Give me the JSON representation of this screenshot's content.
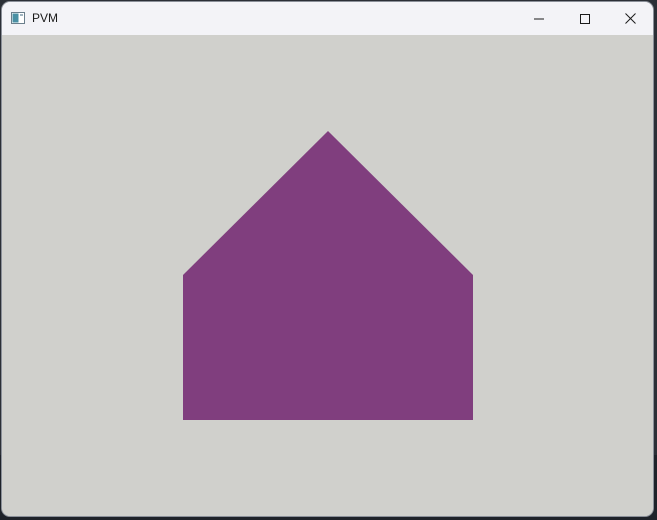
{
  "window": {
    "title": "PVM"
  },
  "titlebar": {
    "icons": {
      "app": "app-window-icon",
      "minimize": "minimize-icon",
      "maximize": "maximize-icon",
      "close": "close-icon"
    }
  },
  "scene": {
    "background_color": "#d0d0cc",
    "shape": "house-pentagon",
    "shape_color": "#803e7e"
  }
}
